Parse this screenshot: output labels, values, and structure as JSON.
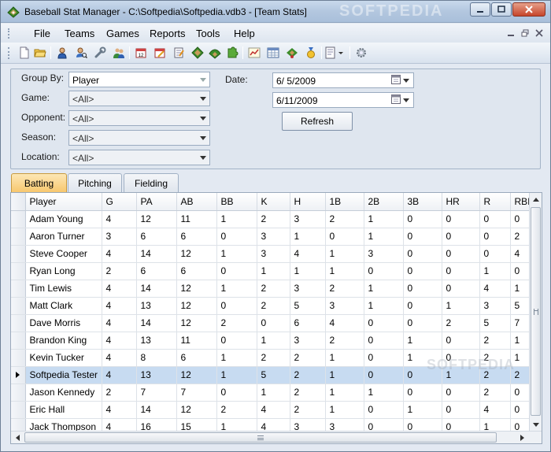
{
  "window": {
    "title": "Baseball Stat Manager - C:\\Softpedia\\Softpedia.vdb3 - [Team Stats]",
    "watermark": "SOFTPEDIA"
  },
  "menu": [
    "File",
    "Teams",
    "Games",
    "Reports",
    "Tools",
    "Help"
  ],
  "toolbar": {
    "icons": [
      "new-file-icon",
      "open-folder-icon",
      "player-icon",
      "player-search-icon",
      "wrench-icon",
      "players-icon",
      "calendar-icon",
      "calendar-edit-icon",
      "notepad-icon",
      "baseball-field-icon",
      "puzzle-icon",
      "chart-icon",
      "table-icon",
      "stadium-icon",
      "award-medal-icon",
      "report-dropdown-icon",
      "settings-gear-icon"
    ]
  },
  "filters": {
    "group_by_label": "Group By:",
    "group_by_value": "Player",
    "game_label": "Game:",
    "game_value": "<All>",
    "opponent_label": "Opponent:",
    "opponent_value": "<All>",
    "season_label": "Season:",
    "season_value": "<All>",
    "location_label": "Location:",
    "location_value": "<All>",
    "date_label": "Date:",
    "date_from": "6/  5/2009",
    "date_to": "6/11/2009",
    "refresh_label": "Refresh"
  },
  "tabs": [
    "Batting",
    "Pitching",
    "Fielding"
  ],
  "active_tab": "Batting",
  "grid": {
    "columns": [
      "Player",
      "G",
      "PA",
      "AB",
      "BB",
      "K",
      "H",
      "1B",
      "2B",
      "3B",
      "HR",
      "R",
      "RBI"
    ],
    "selected_row": 9,
    "rows": [
      [
        "Adam Young",
        "4",
        "12",
        "11",
        "1",
        "2",
        "3",
        "2",
        "1",
        "0",
        "0",
        "0",
        "0"
      ],
      [
        "Aaron Turner",
        "3",
        "6",
        "6",
        "0",
        "3",
        "1",
        "0",
        "1",
        "0",
        "0",
        "0",
        "2"
      ],
      [
        "Steve Cooper",
        "4",
        "14",
        "12",
        "1",
        "3",
        "4",
        "1",
        "3",
        "0",
        "0",
        "0",
        "4"
      ],
      [
        "Ryan Long",
        "2",
        "6",
        "6",
        "0",
        "1",
        "1",
        "1",
        "0",
        "0",
        "0",
        "1",
        "0"
      ],
      [
        "Tim Lewis",
        "4",
        "14",
        "12",
        "1",
        "2",
        "3",
        "2",
        "1",
        "0",
        "0",
        "4",
        "1"
      ],
      [
        "Matt Clark",
        "4",
        "13",
        "12",
        "0",
        "2",
        "5",
        "3",
        "1",
        "0",
        "1",
        "3",
        "5"
      ],
      [
        "Dave Morris",
        "4",
        "14",
        "12",
        "2",
        "0",
        "6",
        "4",
        "0",
        "0",
        "2",
        "5",
        "7"
      ],
      [
        "Brandon King",
        "4",
        "13",
        "11",
        "0",
        "1",
        "3",
        "2",
        "0",
        "1",
        "0",
        "2",
        "1"
      ],
      [
        "Kevin Tucker",
        "4",
        "8",
        "6",
        "1",
        "2",
        "2",
        "1",
        "0",
        "1",
        "0",
        "2",
        "1"
      ],
      [
        "Softpedia Tester",
        "4",
        "13",
        "12",
        "1",
        "5",
        "2",
        "1",
        "0",
        "0",
        "1",
        "2",
        "2"
      ],
      [
        "Jason Kennedy",
        "2",
        "7",
        "7",
        "0",
        "1",
        "2",
        "1",
        "1",
        "0",
        "0",
        "2",
        "0"
      ],
      [
        "Eric Hall",
        "4",
        "14",
        "12",
        "2",
        "4",
        "2",
        "1",
        "0",
        "1",
        "0",
        "4",
        "0"
      ],
      [
        "Jack Thompson",
        "4",
        "16",
        "15",
        "1",
        "4",
        "3",
        "3",
        "0",
        "0",
        "0",
        "1",
        "0"
      ]
    ]
  }
}
